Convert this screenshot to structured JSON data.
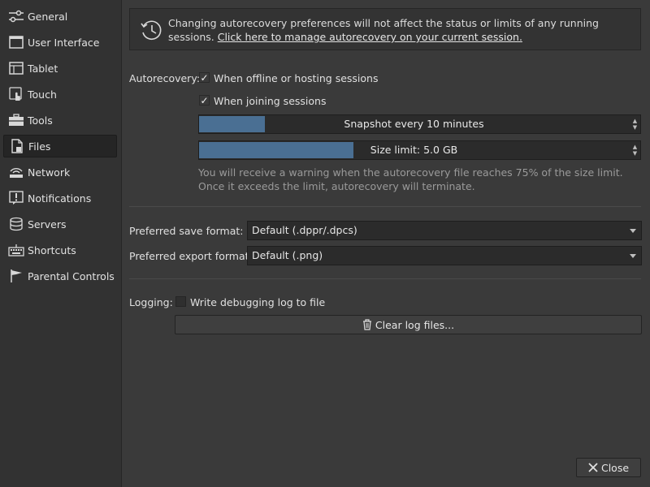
{
  "sidebar": {
    "items": [
      {
        "label": "General",
        "icon": "sliders-icon"
      },
      {
        "label": "User Interface",
        "icon": "window-icon"
      },
      {
        "label": "Tablet",
        "icon": "tablet-icon"
      },
      {
        "label": "Touch",
        "icon": "touch-icon"
      },
      {
        "label": "Tools",
        "icon": "toolbox-icon"
      },
      {
        "label": "Files",
        "icon": "file-icon",
        "selected": true
      },
      {
        "label": "Network",
        "icon": "network-icon"
      },
      {
        "label": "Notifications",
        "icon": "notification-icon"
      },
      {
        "label": "Servers",
        "icon": "database-icon"
      },
      {
        "label": "Shortcuts",
        "icon": "keyboard-icon"
      },
      {
        "label": "Parental Controls",
        "icon": "flag-icon"
      }
    ]
  },
  "notice": {
    "icon": "history-clock-icon",
    "text": "Changing autorecovery preferences will not affect the status or limits of any running sessions. ",
    "link": "Click here to manage autorecovery on your current session."
  },
  "autorecovery": {
    "label": "Autorecovery:",
    "offline_label": "When offline or hosting sessions",
    "offline_checked": true,
    "joining_label": "When joining sessions",
    "joining_checked": true,
    "snapshot_text": "Snapshot every 10 minutes",
    "snapshot_fill": 0.15,
    "size_text": "Size limit: 5.0 GB",
    "size_fill": 0.35,
    "hint": "You will receive a warning when the autorecovery file reaches 75% of the size limit. Once it exceeds the limit, autorecovery will terminate."
  },
  "formats": {
    "save_label": "Preferred save format:",
    "save_value": "Default (.dppr/.dpcs)",
    "export_label": "Preferred export format:",
    "export_value": "Default (.png)"
  },
  "logging": {
    "label": "Logging:",
    "checkbox_label": "Write debugging log to file",
    "checked": false,
    "clear_button": "Clear log files..."
  },
  "footer": {
    "close_button": "Close"
  },
  "colors": {
    "accent": "#4a6f93",
    "background": "#3a3a3a",
    "sidebar": "#323232"
  }
}
